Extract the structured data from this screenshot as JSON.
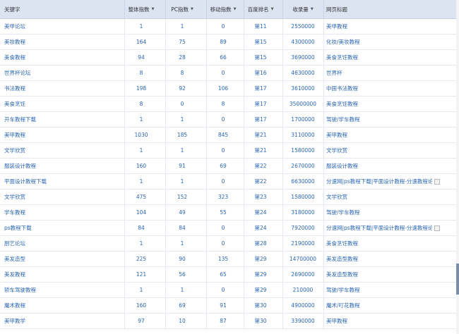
{
  "header": {
    "keyword": "关键字",
    "total_index": "整体指数",
    "pc_index": "PC指数",
    "mobile_index": "移动指数",
    "baidu_rank": "百度排名",
    "indexed": "收录量",
    "page_title": "网页标题",
    "sort_icon": "triangle-down"
  },
  "rows": [
    {
      "keyword": "美甲论坛",
      "total": "1",
      "pc": "1",
      "mobile": "0",
      "rank": "第11",
      "indexed": "2550000",
      "title": "美甲教程",
      "checkbox": false
    },
    {
      "keyword": "美妆教程",
      "total": "164",
      "pc": "75",
      "mobile": "89",
      "rank": "第15",
      "indexed": "4300000",
      "title": "化妆/美妆教程",
      "checkbox": false
    },
    {
      "keyword": "美食教程",
      "total": "94",
      "pc": "28",
      "mobile": "66",
      "rank": "第15",
      "indexed": "3690000",
      "title": "美食烹饪教程",
      "checkbox": false
    },
    {
      "keyword": "世界杯论坛",
      "total": "8",
      "pc": "8",
      "mobile": "0",
      "rank": "第16",
      "indexed": "4630000",
      "title": "世界杯",
      "checkbox": false
    },
    {
      "keyword": "书法教程",
      "total": "198",
      "pc": "92",
      "mobile": "106",
      "rank": "第17",
      "indexed": "3610000",
      "title": "中国书法教程",
      "checkbox": false
    },
    {
      "keyword": "美食烹饪",
      "total": "8",
      "pc": "0",
      "mobile": "8",
      "rank": "第17",
      "indexed": "35000000",
      "title": "美食烹饪教程",
      "checkbox": false
    },
    {
      "keyword": "开车教程下载",
      "total": "1",
      "pc": "1",
      "mobile": "0",
      "rank": "第17",
      "indexed": "1700000",
      "title": "驾驶/学车教程",
      "checkbox": false
    },
    {
      "keyword": "美甲教程",
      "total": "1030",
      "pc": "185",
      "mobile": "845",
      "rank": "第21",
      "indexed": "3110000",
      "title": "美甲教程",
      "checkbox": false
    },
    {
      "keyword": "文学欣赏",
      "total": "1",
      "pc": "1",
      "mobile": "0",
      "rank": "第21",
      "indexed": "1580000",
      "title": "文学欣赏",
      "checkbox": false
    },
    {
      "keyword": "服装设计教程",
      "total": "160",
      "pc": "91",
      "mobile": "69",
      "rank": "第22",
      "indexed": "2670000",
      "title": "服装设计教程",
      "checkbox": false
    },
    {
      "keyword": "平面设计教程下载",
      "total": "1",
      "pc": "1",
      "mobile": "0",
      "rank": "第22",
      "indexed": "6630000",
      "title": "分速网|ps教程下载|平面设计教程-分速教程论...",
      "checkbox": true
    },
    {
      "keyword": "文学欣赏",
      "total": "475",
      "pc": "152",
      "mobile": "323",
      "rank": "第23",
      "indexed": "1580000",
      "title": "文学欣赏",
      "checkbox": false
    },
    {
      "keyword": "学车教程",
      "total": "104",
      "pc": "49",
      "mobile": "55",
      "rank": "第24",
      "indexed": "3180000",
      "title": "驾驶/学车教程",
      "checkbox": false
    },
    {
      "keyword": "ps教程下载",
      "total": "84",
      "pc": "84",
      "mobile": "0",
      "rank": "第24",
      "indexed": "7920000",
      "title": "分速网|ps教程下载|平面设计教程-分速教程论...",
      "checkbox": true
    },
    {
      "keyword": "厨艺论坛",
      "total": "1",
      "pc": "1",
      "mobile": "0",
      "rank": "第28",
      "indexed": "2190000",
      "title": "美食烹饪教程",
      "checkbox": false
    },
    {
      "keyword": "美发造型",
      "total": "225",
      "pc": "90",
      "mobile": "135",
      "rank": "第29",
      "indexed": "14700000",
      "title": "美发造型教程",
      "checkbox": false
    },
    {
      "keyword": "美发教程",
      "total": "121",
      "pc": "56",
      "mobile": "65",
      "rank": "第29",
      "indexed": "2690000",
      "title": "美发造型教程",
      "checkbox": false
    },
    {
      "keyword": "轿车驾驶教程",
      "total": "1",
      "pc": "1",
      "mobile": "0",
      "rank": "第29",
      "indexed": "210000",
      "title": "驾驶/学车教程",
      "checkbox": false
    },
    {
      "keyword": "魔术教程",
      "total": "160",
      "pc": "69",
      "mobile": "91",
      "rank": "第30",
      "indexed": "4900000",
      "title": "魔术/叮花教程",
      "checkbox": false
    },
    {
      "keyword": "美甲教学",
      "total": "97",
      "pc": "10",
      "mobile": "87",
      "rank": "第30",
      "indexed": "3390000",
      "title": "美甲教程",
      "checkbox": false
    }
  ]
}
